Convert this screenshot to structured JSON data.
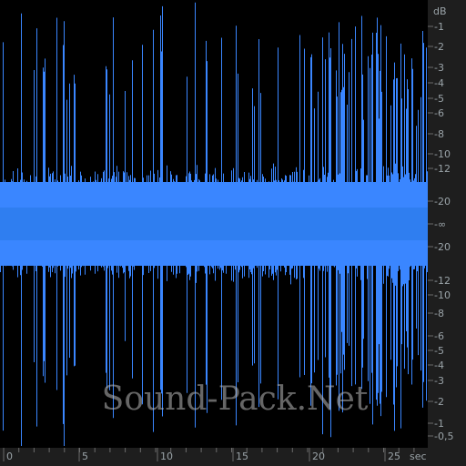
{
  "app": {
    "view": "waveform"
  },
  "colors": {
    "background": "#000000",
    "waveform": "#3a86ff",
    "axis_panel": "#1e1e1e",
    "axis_text": "#9aa3a8",
    "grid_tick": "#6b6b6b"
  },
  "db_axis": {
    "unit_label": "dB",
    "upper_ticks": [
      "-1",
      "-2",
      "-3",
      "-4",
      "-5",
      "-6",
      "-8",
      "-10",
      "-12",
      "-20"
    ],
    "center_label": "-∞",
    "lower_ticks": [
      "-20",
      "-12",
      "-10",
      "-8",
      "-6",
      "-5",
      "-4",
      "-3",
      "-2",
      "-1",
      "-0,5"
    ]
  },
  "time_axis": {
    "ticks": [
      "0",
      "5",
      "10",
      "15",
      "20",
      "25"
    ],
    "unit_label": "sec"
  },
  "watermark": {
    "text": "Sound-Pack.Net"
  },
  "chart_data": {
    "type": "area",
    "xlabel": "sec",
    "ylabel": "dB",
    "xlim": [
      0,
      27.5
    ],
    "x_ticks": [
      0,
      5,
      10,
      15,
      20,
      25
    ],
    "grid": false,
    "legend": "none"
  }
}
